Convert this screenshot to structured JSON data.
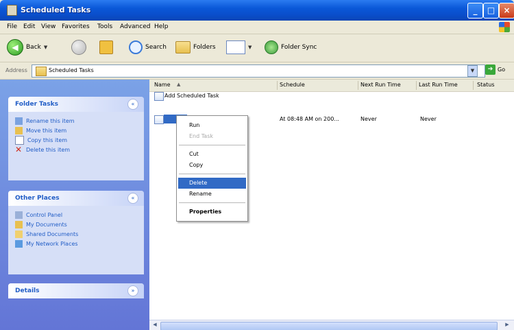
{
  "window": {
    "title": "Scheduled Tasks"
  },
  "menubar": {
    "items": [
      "File",
      "Edit",
      "View",
      "Favorites",
      "Tools",
      "Advanced",
      "Help"
    ]
  },
  "toolbar": {
    "back": "Back",
    "search": "Search",
    "folders": "Folders",
    "folder_sync": "Folder Sync"
  },
  "address": {
    "label": "Address",
    "value": "Scheduled Tasks",
    "go": "Go"
  },
  "panels": {
    "folder_tasks": {
      "title": "Folder Tasks",
      "items": [
        "Rename this item",
        "Move this item",
        "Copy this item",
        "Delete this item"
      ]
    },
    "other_places": {
      "title": "Other Places",
      "items": [
        "Control Panel",
        "My Documents",
        "Shared Documents",
        "My Network Places"
      ]
    },
    "details": {
      "title": "Details"
    }
  },
  "list": {
    "columns": [
      "Name",
      "Schedule",
      "Next Run Time",
      "Last Run Time",
      "Status"
    ],
    "rows": [
      {
        "name": "Add Scheduled Task",
        "schedule": "",
        "next_run": "",
        "last_run": ""
      },
      {
        "name": "",
        "schedule": "At 08:48 AM on 200...",
        "next_run": "Never",
        "last_run": "Never"
      }
    ]
  },
  "context_menu": {
    "items": [
      "Run",
      "End Task",
      "Cut",
      "Copy",
      "Delete",
      "Rename",
      "Properties"
    ],
    "highlighted": "Delete",
    "disabled": [
      "End Task"
    ]
  },
  "colors": {
    "title_blue": "#0a58d8",
    "selection": "#316ac5",
    "link_blue": "#215dc6"
  }
}
